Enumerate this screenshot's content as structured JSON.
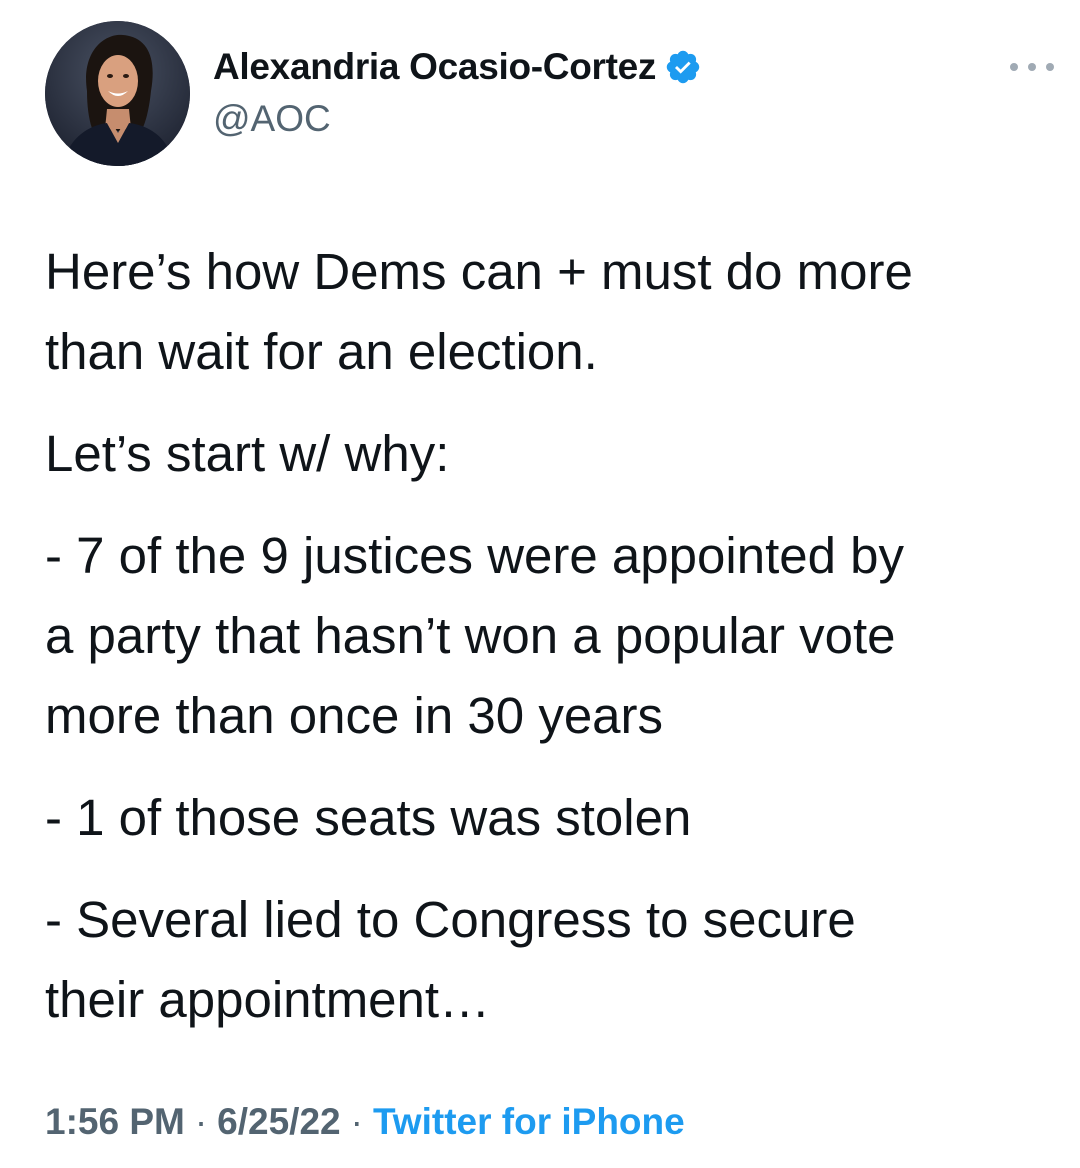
{
  "author": {
    "display_name": "Alexandria Ocasio-Cortez",
    "handle": "@AOC",
    "verified_color": "#1d9bf0",
    "avatar_icon": "profile-photo"
  },
  "more_icon": "more-horizontal-icon",
  "tweet": {
    "paragraphs": [
      [
        "Here’s how Dems can + must do more",
        "than wait for an election."
      ],
      [
        "Let’s start w/ why:"
      ],
      [
        "- 7 of the 9 justices were appointed by",
        "a party that hasn’t won a popular vote",
        "more than once in 30 years"
      ],
      [
        "- 1 of those seats was stolen"
      ],
      [
        "- Several lied to Congress to secure",
        "their appointment…"
      ]
    ]
  },
  "meta": {
    "time": "1:56 PM",
    "separator": "·",
    "date": "6/25/22",
    "source": "Twitter for iPhone",
    "source_color": "#1d9bf0"
  }
}
